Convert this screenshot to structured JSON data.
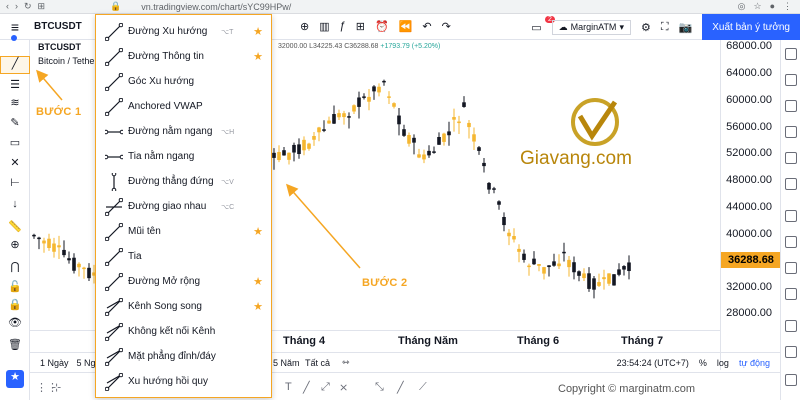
{
  "browser": {
    "url": "vn.tradingview.com/chart/sYC99HPw/",
    "nav_icons": [
      "back-icon",
      "forward-icon",
      "reload-icon",
      "apps-icon"
    ]
  },
  "header": {
    "symbol": "BTCUSDT",
    "notification_count": "2",
    "margin_label": "MarginATM",
    "publish_label": "Xuất bản ý tưởng"
  },
  "chart_info": {
    "title_short": "Bitcoin / Tethe",
    "ohlc_prefix": "32000.00",
    "ohlc_low": "L34225.43",
    "ohlc_close": "C36288.68",
    "ohlc_change": "+1793.79 (+5.20%)"
  },
  "price_axis": {
    "labels": [
      "68000.00",
      "64000.00",
      "60000.00",
      "56000.00",
      "52000.00",
      "48000.00",
      "44000.00",
      "40000.00",
      "32000.00",
      "28000.00"
    ],
    "current_price": "36288.68",
    "current_color": "#f5a623"
  },
  "time_axis": {
    "labels": [
      "Tháng 4",
      "Tháng Năm",
      "Tháng 6",
      "Tháng 7"
    ]
  },
  "bottom_bar": {
    "left": [
      "1 Ngày",
      "5 Ng",
      "5 Năm",
      "Tất cả"
    ],
    "time": "23:54:24 (UTC+7)",
    "percent": "%",
    "log": "log",
    "auto": "tự động"
  },
  "copyright": "Copyright © marginatm.com",
  "logo_text": "Giavang.com",
  "steps": {
    "step1": "BƯỚC 1",
    "step2": "BƯỚC 2"
  },
  "dropdown": {
    "items": [
      {
        "label": "Đường Xu hướng",
        "shortcut": "⌥T",
        "starred": true,
        "icon": "trend-line-icon"
      },
      {
        "label": "Đường Thông tin",
        "shortcut": "",
        "starred": true,
        "icon": "info-line-icon"
      },
      {
        "label": "Góc Xu hướng",
        "shortcut": "",
        "starred": false,
        "icon": "trend-angle-icon"
      },
      {
        "label": "Anchored VWAP",
        "shortcut": "",
        "starred": false,
        "icon": "anchored-vwap-icon"
      },
      {
        "label": "Đường nằm ngang",
        "shortcut": "⌥H",
        "starred": false,
        "icon": "horizontal-line-icon"
      },
      {
        "label": "Tia nằm ngang",
        "shortcut": "",
        "starred": false,
        "icon": "horizontal-ray-icon"
      },
      {
        "label": "Đường thẳng đứng",
        "shortcut": "⌥V",
        "starred": false,
        "icon": "vertical-line-icon"
      },
      {
        "label": "Đường giao nhau",
        "shortcut": "⌥C",
        "starred": false,
        "icon": "cross-line-icon"
      },
      {
        "label": "Mũi tên",
        "shortcut": "",
        "starred": true,
        "icon": "arrow-icon"
      },
      {
        "label": "Tia",
        "shortcut": "",
        "starred": false,
        "icon": "ray-icon"
      },
      {
        "label": "Đường Mở rộng",
        "shortcut": "",
        "starred": true,
        "icon": "extended-line-icon"
      },
      {
        "label": "Kênh Song song",
        "shortcut": "",
        "starred": true,
        "icon": "parallel-channel-icon"
      },
      {
        "label": "Không kết nối Kênh",
        "shortcut": "",
        "starred": false,
        "icon": "disjoint-channel-icon"
      },
      {
        "label": "Mặt phẳng đỉnh/đáy",
        "shortcut": "",
        "starred": false,
        "icon": "flat-top-bottom-icon"
      },
      {
        "label": "Xu hướng hồi quy",
        "shortcut": "",
        "starred": false,
        "icon": "regression-trend-icon"
      }
    ],
    "star_glyph": "★"
  },
  "colors": {
    "up": "#f5b731",
    "down": "#131722",
    "accent": "#2962ff",
    "highlight": "#f5a623"
  }
}
